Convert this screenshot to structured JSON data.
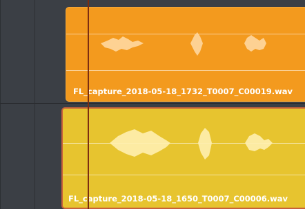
{
  "timeline": {
    "clips": [
      {
        "label": "FL_capture_2018-05-18_1732_T0007_C00019.wav",
        "color": "#f39a1e",
        "selected": false
      },
      {
        "label": "FL_capture_2018-05-18_1650_T0007_C00006.wav",
        "color": "#e7c42f",
        "selected": true
      }
    ],
    "playhead_color": "#7b2d12",
    "selection_border_color": "#c7613c"
  }
}
